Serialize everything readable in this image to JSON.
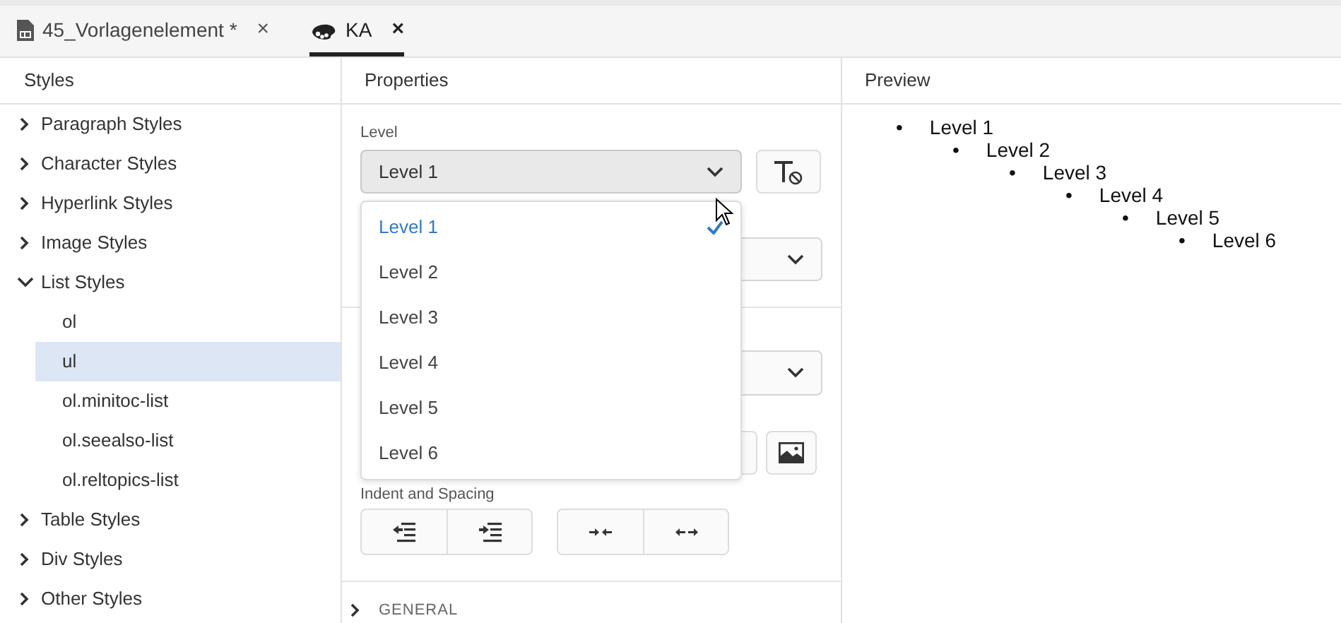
{
  "tabs": [
    {
      "kind": "document",
      "label": "45_Vorlagenelement *",
      "selected": false,
      "close": "×"
    },
    {
      "kind": "palette",
      "label": "KA",
      "selected": true,
      "close": "×"
    }
  ],
  "styles_panel": {
    "title": "Styles",
    "items": [
      {
        "label": "Paragraph Styles",
        "expanded": false,
        "selected": false
      },
      {
        "label": "Character Styles",
        "expanded": false,
        "selected": false
      },
      {
        "label": "Hyperlink Styles",
        "expanded": false,
        "selected": false
      },
      {
        "label": "Image Styles",
        "expanded": false,
        "selected": false
      },
      {
        "label": "List Styles",
        "expanded": true,
        "selected": false,
        "children": [
          {
            "label": "ol",
            "selected": false
          },
          {
            "label": "ul",
            "selected": true
          },
          {
            "label": "ol.minitoc-list",
            "selected": false
          },
          {
            "label": "ol.seealso-list",
            "selected": false
          },
          {
            "label": "ol.reltopics-list",
            "selected": false
          }
        ]
      },
      {
        "label": "Table Styles",
        "expanded": false,
        "selected": false
      },
      {
        "label": "Div Styles",
        "expanded": false,
        "selected": false
      },
      {
        "label": "Other Styles",
        "expanded": false,
        "selected": false
      }
    ]
  },
  "properties_panel": {
    "title": "Properties",
    "level_field": {
      "label": "Level",
      "value": "Level 1",
      "open": true,
      "options": [
        {
          "label": "Level 1",
          "selected": true
        },
        {
          "label": "Level 2",
          "selected": false
        },
        {
          "label": "Level 3",
          "selected": false
        },
        {
          "label": "Level 4",
          "selected": false
        },
        {
          "label": "Level 5",
          "selected": false
        },
        {
          "label": "Level 6",
          "selected": false
        }
      ]
    },
    "indent_label": "Indent and Spacing",
    "section": {
      "label": "GENERAL",
      "expanded": false
    }
  },
  "preview_panel": {
    "title": "Preview",
    "list": [
      {
        "marker": "•",
        "text": "Level 1",
        "children": [
          {
            "marker": "•",
            "text": "Level 2",
            "children": [
              {
                "marker": "•",
                "text": "Level 3",
                "children": [
                  {
                    "marker": "•",
                    "text": "Level 4",
                    "children": [
                      {
                        "marker": "•",
                        "text": "Level 5",
                        "children": [
                          {
                            "marker": "•",
                            "text": "Level 6"
                          }
                        ]
                      }
                    ]
                  }
                ]
              }
            ]
          }
        ]
      }
    ]
  }
}
